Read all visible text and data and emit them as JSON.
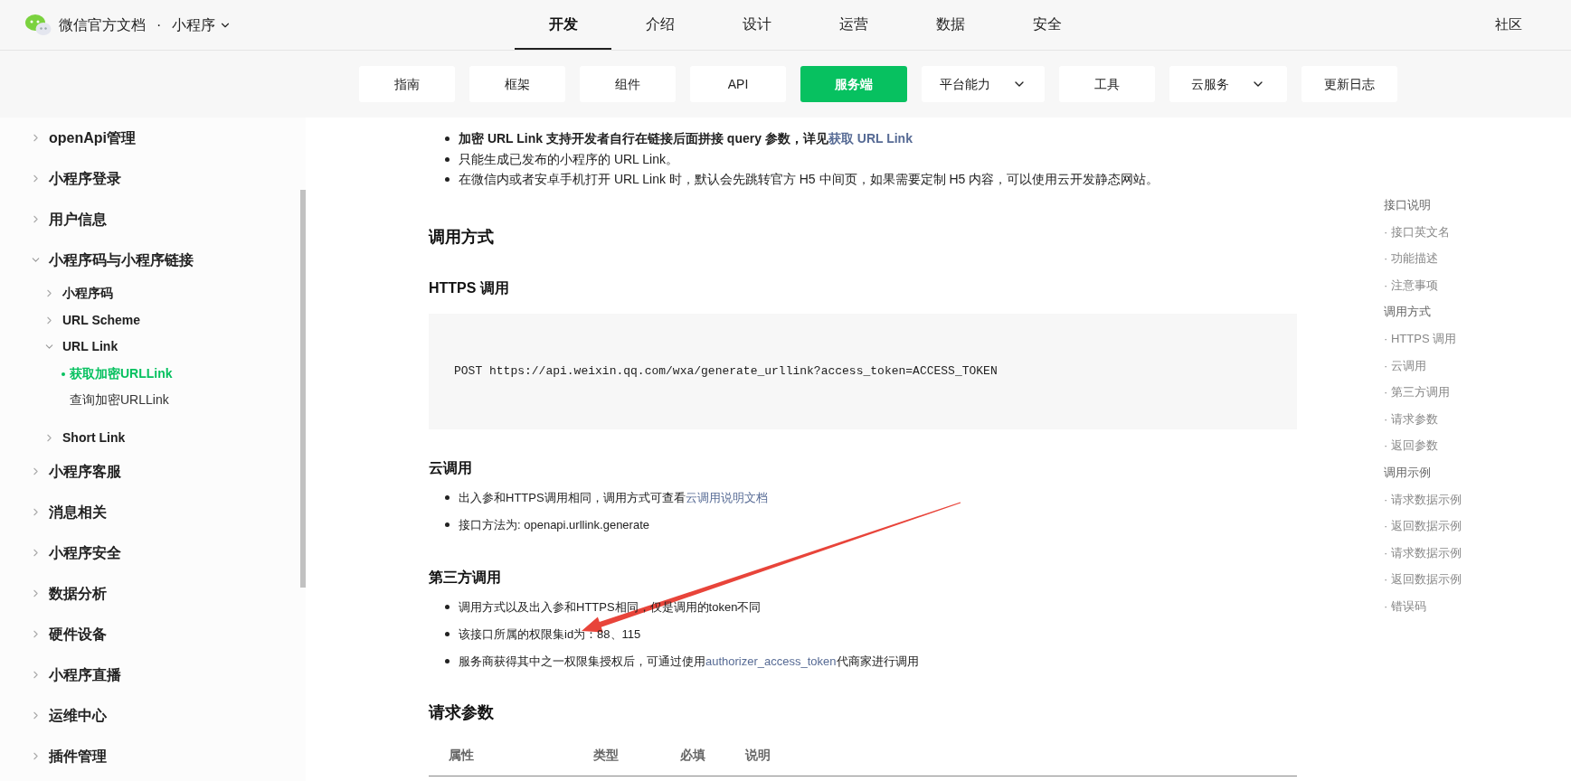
{
  "header": {
    "site_title": "微信官方文档",
    "separator": "·",
    "product": "小程序",
    "nav": [
      {
        "label": "开发",
        "selected": true
      },
      {
        "label": "介绍",
        "selected": false
      },
      {
        "label": "设计",
        "selected": false
      },
      {
        "label": "运营",
        "selected": false
      },
      {
        "label": "数据",
        "selected": false
      },
      {
        "label": "安全",
        "selected": false
      }
    ],
    "right_links": [
      "社区"
    ]
  },
  "subnav": [
    {
      "label": "指南",
      "selected": false,
      "kind": "plain"
    },
    {
      "label": "框架",
      "selected": false,
      "kind": "plain"
    },
    {
      "label": "组件",
      "selected": false,
      "kind": "plain"
    },
    {
      "label": "API",
      "selected": false,
      "kind": "plain"
    },
    {
      "label": "服务端",
      "selected": true,
      "kind": "plain"
    },
    {
      "label": "平台能力",
      "selected": false,
      "kind": "dropdown"
    },
    {
      "label": "工具",
      "selected": false,
      "kind": "plain"
    },
    {
      "label": "云服务",
      "selected": false,
      "kind": "dropdown"
    },
    {
      "label": "更新日志",
      "selected": false,
      "kind": "plain"
    }
  ],
  "sidebar": {
    "items": [
      {
        "label": "openApi管理",
        "kind": "group",
        "expanded": false,
        "selected": false
      },
      {
        "label": "小程序登录",
        "kind": "group",
        "expanded": false,
        "selected": false
      },
      {
        "label": "用户信息",
        "kind": "group",
        "expanded": false,
        "selected": false
      },
      {
        "label": "小程序码与小程序链接",
        "kind": "group",
        "expanded": true,
        "selected": false,
        "children": [
          {
            "label": "小程序码",
            "kind": "group",
            "expanded": false,
            "selected": false
          },
          {
            "label": "URL Scheme",
            "kind": "group",
            "expanded": false,
            "selected": false
          },
          {
            "label": "URL Link",
            "kind": "group",
            "expanded": true,
            "selected": false,
            "children": [
              {
                "label": "获取加密URLLink",
                "kind": "page",
                "selected": true
              },
              {
                "label": "查询加密URLLink",
                "kind": "page",
                "selected": false
              }
            ]
          },
          {
            "label": "Short Link",
            "kind": "group",
            "expanded": false,
            "selected": false
          }
        ]
      },
      {
        "label": "小程序客服",
        "kind": "group",
        "expanded": false,
        "selected": false
      },
      {
        "label": "消息相关",
        "kind": "group",
        "expanded": false,
        "selected": false
      },
      {
        "label": "小程序安全",
        "kind": "group",
        "expanded": false,
        "selected": false
      },
      {
        "label": "数据分析",
        "kind": "group",
        "expanded": false,
        "selected": false
      },
      {
        "label": "硬件设备",
        "kind": "group",
        "expanded": false,
        "selected": false
      },
      {
        "label": "小程序直播",
        "kind": "group",
        "expanded": false,
        "selected": false
      },
      {
        "label": "运维中心",
        "kind": "group",
        "expanded": false,
        "selected": false
      },
      {
        "label": "插件管理",
        "kind": "group",
        "expanded": false,
        "selected": false
      }
    ]
  },
  "content": {
    "blocks": [
      {
        "kind": "notes",
        "items": [
          {
            "bold": true,
            "parts": [
              {
                "kind": "text",
                "text": "加密 URL Link 支持开发者自行在链接后面拼接 query 参数，详见"
              },
              {
                "kind": "link",
                "text": "获取 URL Link"
              }
            ]
          },
          {
            "bold": false,
            "parts": [
              {
                "kind": "text",
                "text": "只能生成已发布的小程序的 URL Link。"
              }
            ]
          },
          {
            "bold": false,
            "parts": [
              {
                "kind": "text",
                "text": "在微信内或者安卓手机打开 URL Link 时，默认会先跳转官方 H5 中间页，如果需要定制 H5 内容，可以使用云开发静态网站。"
              }
            ]
          }
        ]
      },
      {
        "kind": "h2",
        "text": "调用方式"
      },
      {
        "kind": "h3",
        "text": "HTTPS 调用"
      },
      {
        "kind": "code",
        "text": "POST https://api.weixin.qq.com/wxa/generate_urllink?access_token=ACCESS_TOKEN"
      },
      {
        "kind": "h3",
        "text": "云调用"
      },
      {
        "kind": "bullets",
        "items": [
          {
            "bold": false,
            "parts": [
              {
                "kind": "text",
                "text": "出入参和HTTPS调用相同，调用方式可查看"
              },
              {
                "kind": "link",
                "text": "云调用说明文档"
              }
            ]
          },
          {
            "bold": false,
            "parts": [
              {
                "kind": "text",
                "text": "接口方法为: openapi.urllink.generate"
              }
            ]
          }
        ]
      },
      {
        "kind": "h3",
        "text": "第三方调用"
      },
      {
        "kind": "bullets",
        "items": [
          {
            "bold": false,
            "parts": [
              {
                "kind": "text",
                "text": "调用方式以及出入参和HTTPS相同，仅是调用的token不同"
              }
            ]
          },
          {
            "bold": false,
            "parts": [
              {
                "kind": "text",
                "text": "该接口所属的权限集id为：88、115"
              }
            ]
          },
          {
            "bold": false,
            "parts": [
              {
                "kind": "text",
                "text": "服务商获得其中之一权限集授权后，可通过使用"
              },
              {
                "kind": "link",
                "text": "authorizer_access_token"
              },
              {
                "kind": "text",
                "text": "代商家进行调用"
              }
            ]
          }
        ]
      },
      {
        "kind": "h2",
        "text": "请求参数"
      },
      {
        "kind": "table",
        "columns": [
          "属性",
          "类型",
          "必填",
          "说明"
        ]
      }
    ]
  },
  "toc": [
    {
      "kind": "section",
      "text": "接口说明"
    },
    {
      "kind": "sub",
      "text": "· 接口英文名"
    },
    {
      "kind": "sub",
      "text": "· 功能描述"
    },
    {
      "kind": "sub",
      "text": "· 注意事项"
    },
    {
      "kind": "section",
      "text": "调用方式"
    },
    {
      "kind": "sub",
      "text": "· HTTPS 调用"
    },
    {
      "kind": "sub",
      "text": "· 云调用"
    },
    {
      "kind": "sub",
      "text": "· 第三方调用"
    },
    {
      "kind": "sub",
      "text": "· 请求参数"
    },
    {
      "kind": "sub",
      "text": "· 返回参数"
    },
    {
      "kind": "section",
      "text": "调用示例"
    },
    {
      "kind": "sub",
      "text": "· 请求数据示例"
    },
    {
      "kind": "sub",
      "text": "· 返回数据示例"
    },
    {
      "kind": "sub",
      "text": "· 请求数据示例"
    },
    {
      "kind": "sub",
      "text": "· 返回数据示例"
    },
    {
      "kind": "sub",
      "text": "· 错误码"
    }
  ]
}
